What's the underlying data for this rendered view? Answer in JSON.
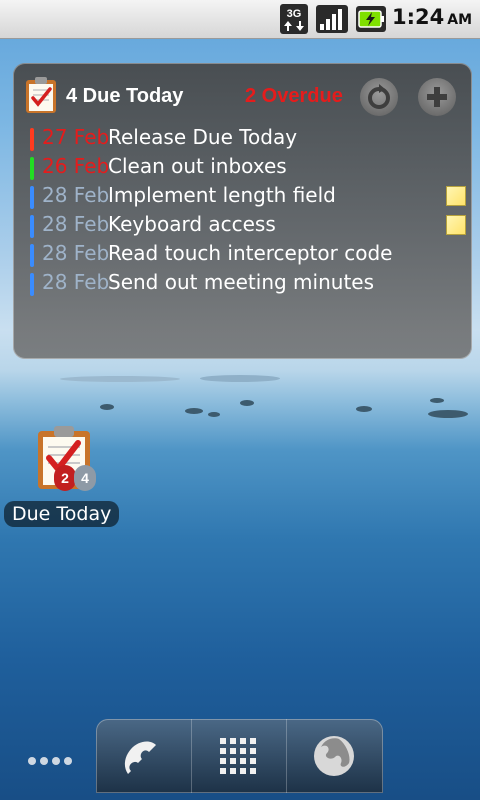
{
  "statusbar": {
    "network_icon": "3g-icon",
    "signal_icon": "signal-strength-icon",
    "battery_icon": "battery-charging-icon",
    "time": "1:24",
    "ampm": "AM"
  },
  "widget": {
    "title": "4 Due Today",
    "overdue": "2 Overdue",
    "refresh_icon": "refresh-icon",
    "add_icon": "add-icon",
    "tasks": [
      {
        "date": "27 Feb",
        "title": "Release Due Today",
        "bar_color": "#ff3b1f",
        "date_color": "red",
        "note": false
      },
      {
        "date": "26 Feb",
        "title": "Clean out inboxes",
        "bar_color": "#22dd22",
        "date_color": "red",
        "note": false
      },
      {
        "date": "28 Feb",
        "title": "Implement length field",
        "bar_color": "#3a8cff",
        "date_color": "gray",
        "note": true
      },
      {
        "date": "28 Feb",
        "title": "Keyboard access",
        "bar_color": "#3a8cff",
        "date_color": "gray",
        "note": true
      },
      {
        "date": "28 Feb",
        "title": "Read touch interceptor code",
        "bar_color": "#3a8cff",
        "date_color": "gray",
        "note": false
      },
      {
        "date": "28 Feb",
        "title": "Send out meeting minutes",
        "bar_color": "#3a8cff",
        "date_color": "gray",
        "note": false
      }
    ]
  },
  "shortcut": {
    "label": "Due Today",
    "badge_overdue": "2",
    "badge_due": "4",
    "icon": "clipboard-checklist-icon"
  },
  "dock": {
    "phone_icon": "phone-icon",
    "apps_icon": "app-grid-icon",
    "browser_icon": "globe-icon"
  }
}
